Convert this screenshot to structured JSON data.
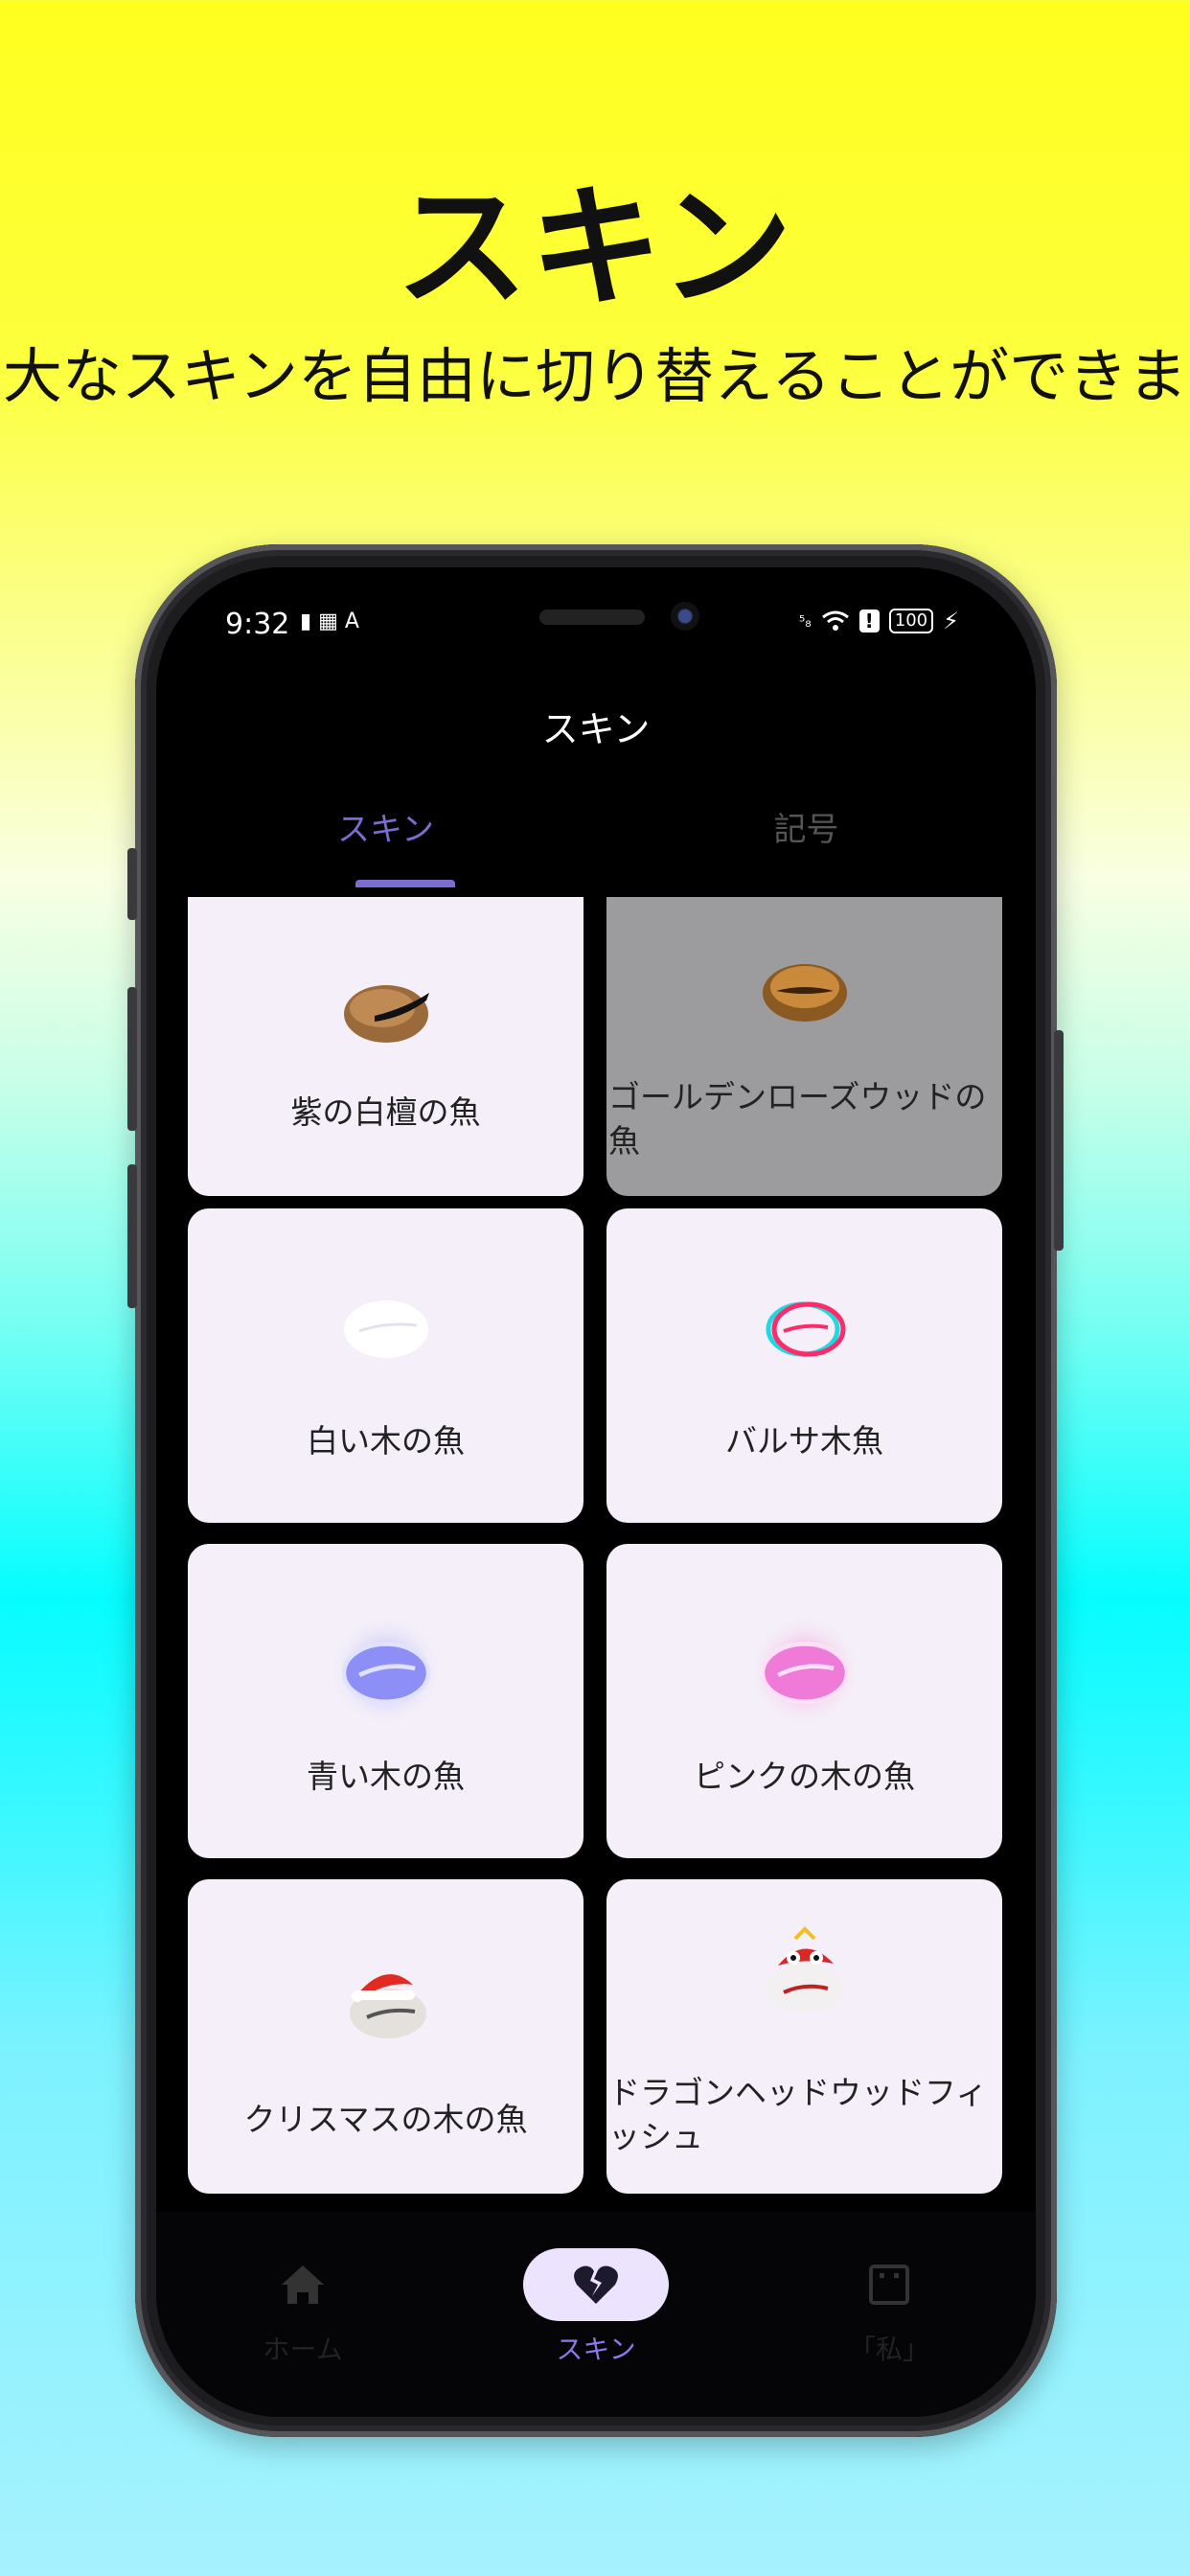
{
  "promo": {
    "title": "スキン",
    "subtitle": "大なスキンを自由に切り替えることができま"
  },
  "status_bar": {
    "time": "9:32",
    "battery": "100"
  },
  "app": {
    "title": "スキン"
  },
  "tabs": [
    {
      "label": "スキン",
      "active": true
    },
    {
      "label": "記号",
      "active": false
    }
  ],
  "skins": [
    {
      "label": "紫の白檀の魚",
      "icon": "wooden-fish-brown-icon",
      "selected": false
    },
    {
      "label": "ゴールデンローズウッドの魚",
      "icon": "wooden-fish-gold-icon",
      "selected": true
    },
    {
      "label": "白い木の魚",
      "icon": "wooden-fish-white-icon",
      "selected": false
    },
    {
      "label": "バルサ木魚",
      "icon": "wooden-fish-glitch-icon",
      "selected": false
    },
    {
      "label": "青い木の魚",
      "icon": "wooden-fish-blue-glow-icon",
      "selected": false
    },
    {
      "label": "ピンクの木の魚",
      "icon": "wooden-fish-pink-glow-icon",
      "selected": false
    },
    {
      "label": "クリスマスの木の魚",
      "icon": "wooden-fish-christmas-icon",
      "selected": false
    },
    {
      "label": "ドラゴンヘッドウッドフィッシュ",
      "icon": "wooden-fish-dragon-icon",
      "selected": false
    }
  ],
  "bottom_nav": [
    {
      "label": "ホーム",
      "icon": "home-icon",
      "active": false
    },
    {
      "label": "スキン",
      "icon": "broken-heart-icon",
      "active": true
    },
    {
      "label": "「私」",
      "icon": "profile-icon",
      "active": false
    }
  ],
  "colors": {
    "accent": "#7b6cd0",
    "card_bg": "#f4eff8",
    "card_selected_bg": "#9c9b9e",
    "nav_pill": "#ece3ff"
  }
}
